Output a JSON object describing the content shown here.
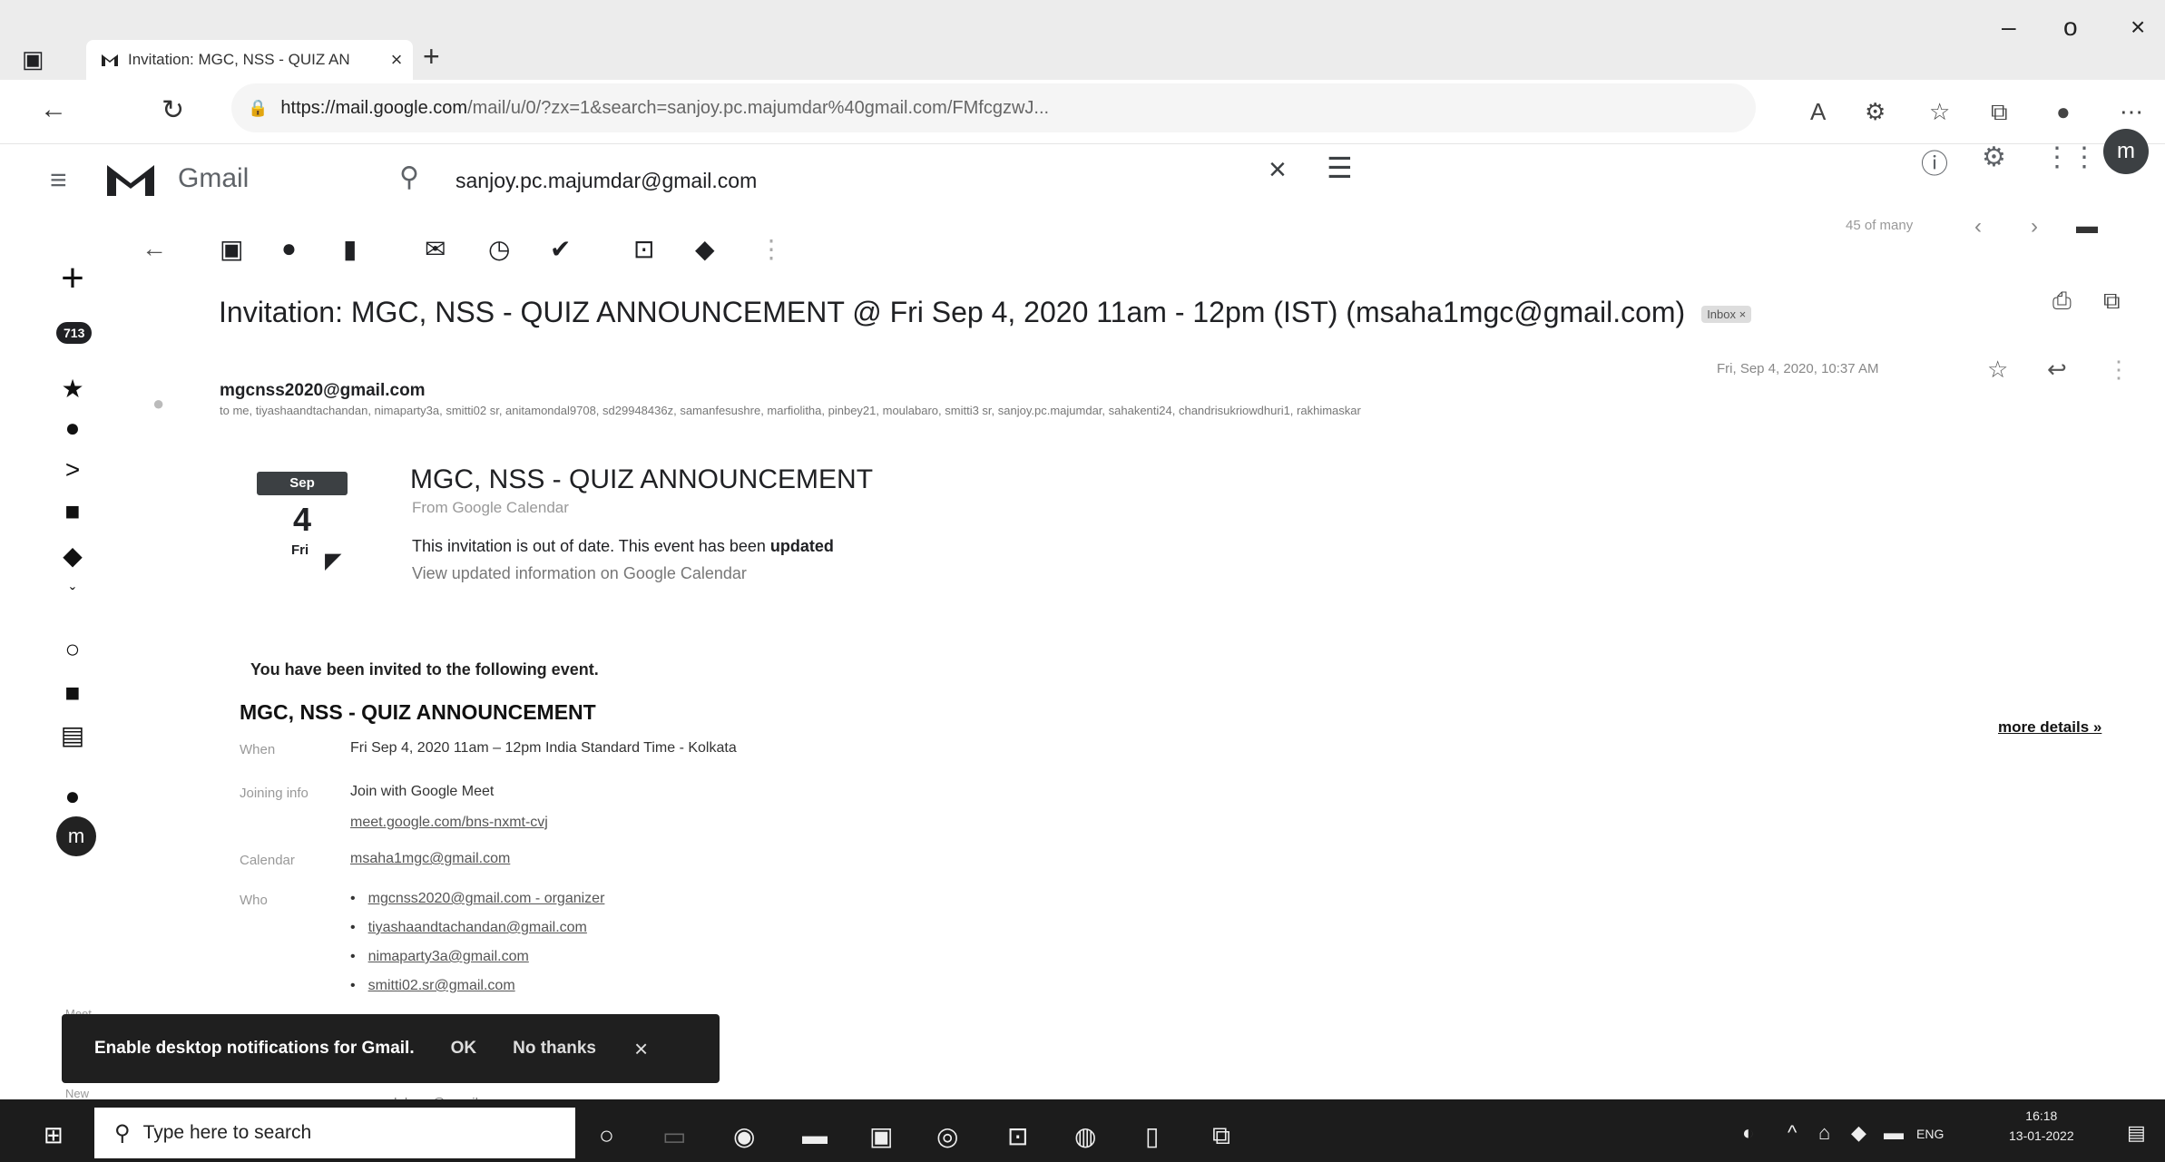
{
  "browser": {
    "tab_title": "Invitation: MGC, NSS - QUIZ AN",
    "tab_close": "×",
    "new_tab": "+",
    "url_host": "https://mail.google.com",
    "url_rest": "/mail/u/0/?zx=1&search=sanjoy.pc.majumdar%40gmail.com/FMfcgzwJ...",
    "win_minimize": "–",
    "win_maximize": "o",
    "win_close": "×"
  },
  "gmail": {
    "app_name": "Gmail",
    "search_value": "sanjoy.pc.majumdar@gmail.com",
    "search_clear": "×",
    "avatar_letter": "m"
  },
  "toolbar": {
    "counter": "45 of many"
  },
  "rail": {
    "badge": "713",
    "avatar_letter": "m"
  },
  "message": {
    "subject": "Invitation: MGC, NSS - QUIZ ANNOUNCEMENT @ Fri Sep 4, 2020 11am - 12pm (IST) (msaha1mgc@gmail.com)",
    "inbox_label": "Inbox ×",
    "sender": "mgcnss2020@gmail.com",
    "to_line": "to me, tiyashaandtachandan, nimaparty3a, smitti02 sr, anitamondal9708, sd29948436z, samanfesushre, marfiolitha, pinbey21, moulabaro, smitti3 sr, sanjoy.pc.majumdar, sahakenti24, chandrisukriowdhuri1, rakhimaskar",
    "date": "Fri, Sep 4, 2020, 10:37 AM"
  },
  "calendar_card": {
    "month": "Sep",
    "day": "4",
    "weekday": "Fri",
    "title": "MGC, NSS - QUIZ ANNOUNCEMENT",
    "from": "From Google Calendar",
    "outdated_text": "This invitation is out of date. This event has been ",
    "outdated_bold": "updated",
    "view_updated": "View updated information on Google Calendar"
  },
  "invite": {
    "heading": "You have been invited to the following event.",
    "event_name": "MGC, NSS - QUIZ ANNOUNCEMENT",
    "more_details": "more details »",
    "when_label": "When",
    "when_value": "Fri Sep 4, 2020 11am – 12pm India Standard Time - Kolkata",
    "joining_label": "Joining info",
    "joining_value": "Join with Google Meet",
    "meet_link": "meet.google.com/bns-nxmt-cvj",
    "calendar_label": "Calendar",
    "calendar_value": "msaha1mgc@gmail.com",
    "who_label": "Who",
    "who": [
      "mgcnss2020@gmail.com - organizer",
      "tiyashaandtachandan@gmail.com",
      "nimaparty3a@gmail.com",
      "smitti02.sr@gmail.com"
    ],
    "hidden_guest": "moulabaro@gmail.com"
  },
  "notification": {
    "text": "Enable desktop notifications for Gmail.",
    "ok": "OK",
    "no_thanks": "No thanks",
    "close": "×"
  },
  "left_labels": {
    "upper": "Meet",
    "lower": "New"
  },
  "taskbar": {
    "search_placeholder": "Type here to search",
    "time": "16:18",
    "date": "13-01-2022",
    "lang": "ENG"
  }
}
